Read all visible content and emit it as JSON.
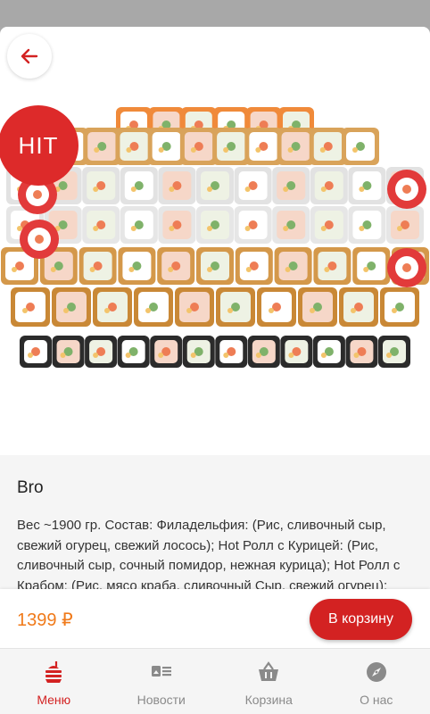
{
  "product": {
    "badge": "HIT",
    "title": "Bro",
    "description": "Вес ~1900 гр. Состав: Филадельфия: (Рис, сливочный сыр, свежий огурец, свежий лосось); Hot Ролл с Курицей: (Рис, сливочный сыр, сочный помидор, нежная курица); Hot Ролл с Крабом: (Рис, мясо краба, сливочный Сыр, свежий огурец); Ролл"
  },
  "buy": {
    "price": "1399 ₽",
    "cart_label": "В корзину"
  },
  "tabs": [
    {
      "label": "Меню",
      "icon": "menu-food-icon",
      "active": true
    },
    {
      "label": "Новости",
      "icon": "news-icon",
      "active": false
    },
    {
      "label": "Корзина",
      "icon": "basket-icon",
      "active": false
    },
    {
      "label": "О нас",
      "icon": "compass-icon",
      "active": false
    }
  ],
  "colors": {
    "accent": "#d32222",
    "price": "#f07a1a",
    "tab_inactive": "#8a8a8a"
  }
}
